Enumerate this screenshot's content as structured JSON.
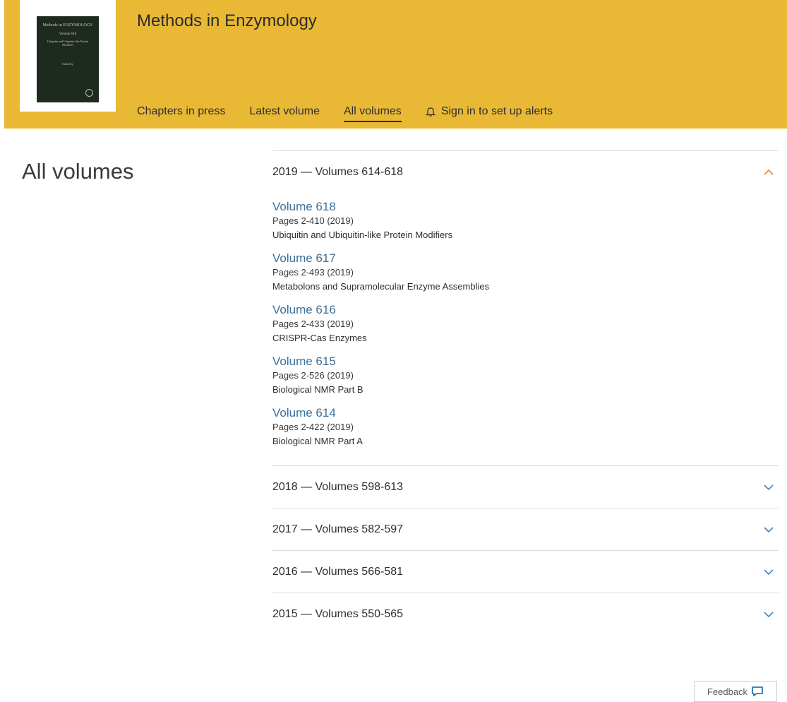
{
  "header": {
    "journal_title": "Methods in Enzymology",
    "cover": {
      "line1": "Methods in ENZYMOLOGY",
      "line2": "Volume 618",
      "line3": "Ubiquitin and Ubiquitin-like Protein Modifiers",
      "line4": "Edited by"
    },
    "nav": {
      "chapters_in_press": "Chapters in press",
      "latest_volume": "Latest volume",
      "all_volumes": "All volumes",
      "alerts": "Sign in to set up alerts"
    },
    "colors": {
      "banner": "#e9b935",
      "link": "#3e6f97",
      "chevron": "#2f74b5",
      "chevron_open": "#e07a1f"
    }
  },
  "page_title": "All volumes",
  "sections": [
    {
      "label": "2019 — Volumes 614-618",
      "expanded": true,
      "volumes": [
        {
          "title": "Volume 618",
          "pages": "Pages 2-410 (2019)",
          "description": "Ubiquitin and Ubiquitin-like Protein Modifiers"
        },
        {
          "title": "Volume 617",
          "pages": "Pages 2-493 (2019)",
          "description": "Metabolons and Supramolecular Enzyme Assemblies"
        },
        {
          "title": "Volume 616",
          "pages": "Pages 2-433 (2019)",
          "description": "CRISPR-Cas Enzymes"
        },
        {
          "title": "Volume 615",
          "pages": "Pages 2-526 (2019)",
          "description": "Biological NMR Part B"
        },
        {
          "title": "Volume 614",
          "pages": "Pages 2-422 (2019)",
          "description": "Biological NMR Part A"
        }
      ]
    },
    {
      "label": "2018 — Volumes 598-613",
      "expanded": false
    },
    {
      "label": "2017 — Volumes 582-597",
      "expanded": false
    },
    {
      "label": "2016 — Volumes 566-581",
      "expanded": false
    },
    {
      "label": "2015 — Volumes 550-565",
      "expanded": false
    }
  ],
  "feedback_label": "Feedback"
}
